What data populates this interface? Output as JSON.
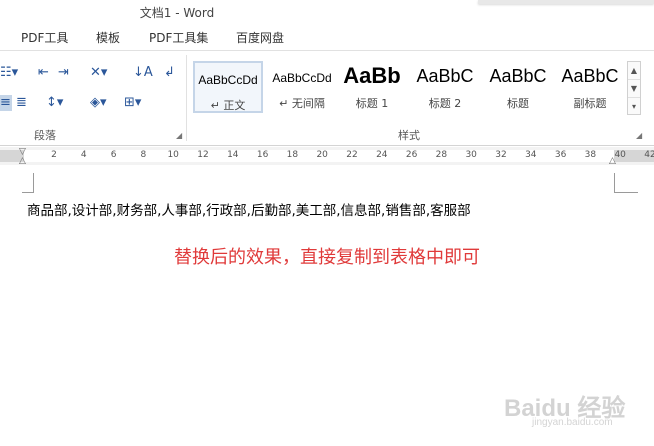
{
  "window": {
    "title": "文档1 - Word"
  },
  "menu_tabs": [
    "PDF工具",
    "模板",
    "PDF工具集",
    "百度网盘"
  ],
  "ribbon": {
    "paragraph_group_label": "段落",
    "styles_group_label": "样式",
    "styles": [
      {
        "sample": "AaBbCcDd",
        "name": "↵ 正文",
        "selected": true
      },
      {
        "sample": "AaBbCcDd",
        "name": "↵ 无间隔",
        "selected": false
      },
      {
        "sample": "AaBb",
        "name": "标题 1",
        "selected": false
      },
      {
        "sample": "AaBbC",
        "name": "标题 2",
        "selected": false
      },
      {
        "sample": "AaBbC",
        "name": "标题",
        "selected": false
      },
      {
        "sample": "AaBbC",
        "name": "副标题",
        "selected": false
      }
    ]
  },
  "ruler": {
    "ticks": [
      "2",
      "4",
      "6",
      "8",
      "10",
      "12",
      "14",
      "16",
      "18",
      "20",
      "22",
      "24",
      "26",
      "28",
      "30",
      "32",
      "34",
      "36",
      "38",
      "40",
      "42"
    ]
  },
  "document": {
    "line1": "商品部,设计部,财务部,人事部,行政部,后勤部,美工部,信息部,销售部,客服部",
    "caption": "替换后的效果，直接复制到表格中即可"
  },
  "watermark": {
    "text": "Baidu 经验",
    "sub": "jingyan.baidu.com"
  },
  "colors": {
    "accent": "#2b579a",
    "caption_red": "#e03a3a"
  }
}
